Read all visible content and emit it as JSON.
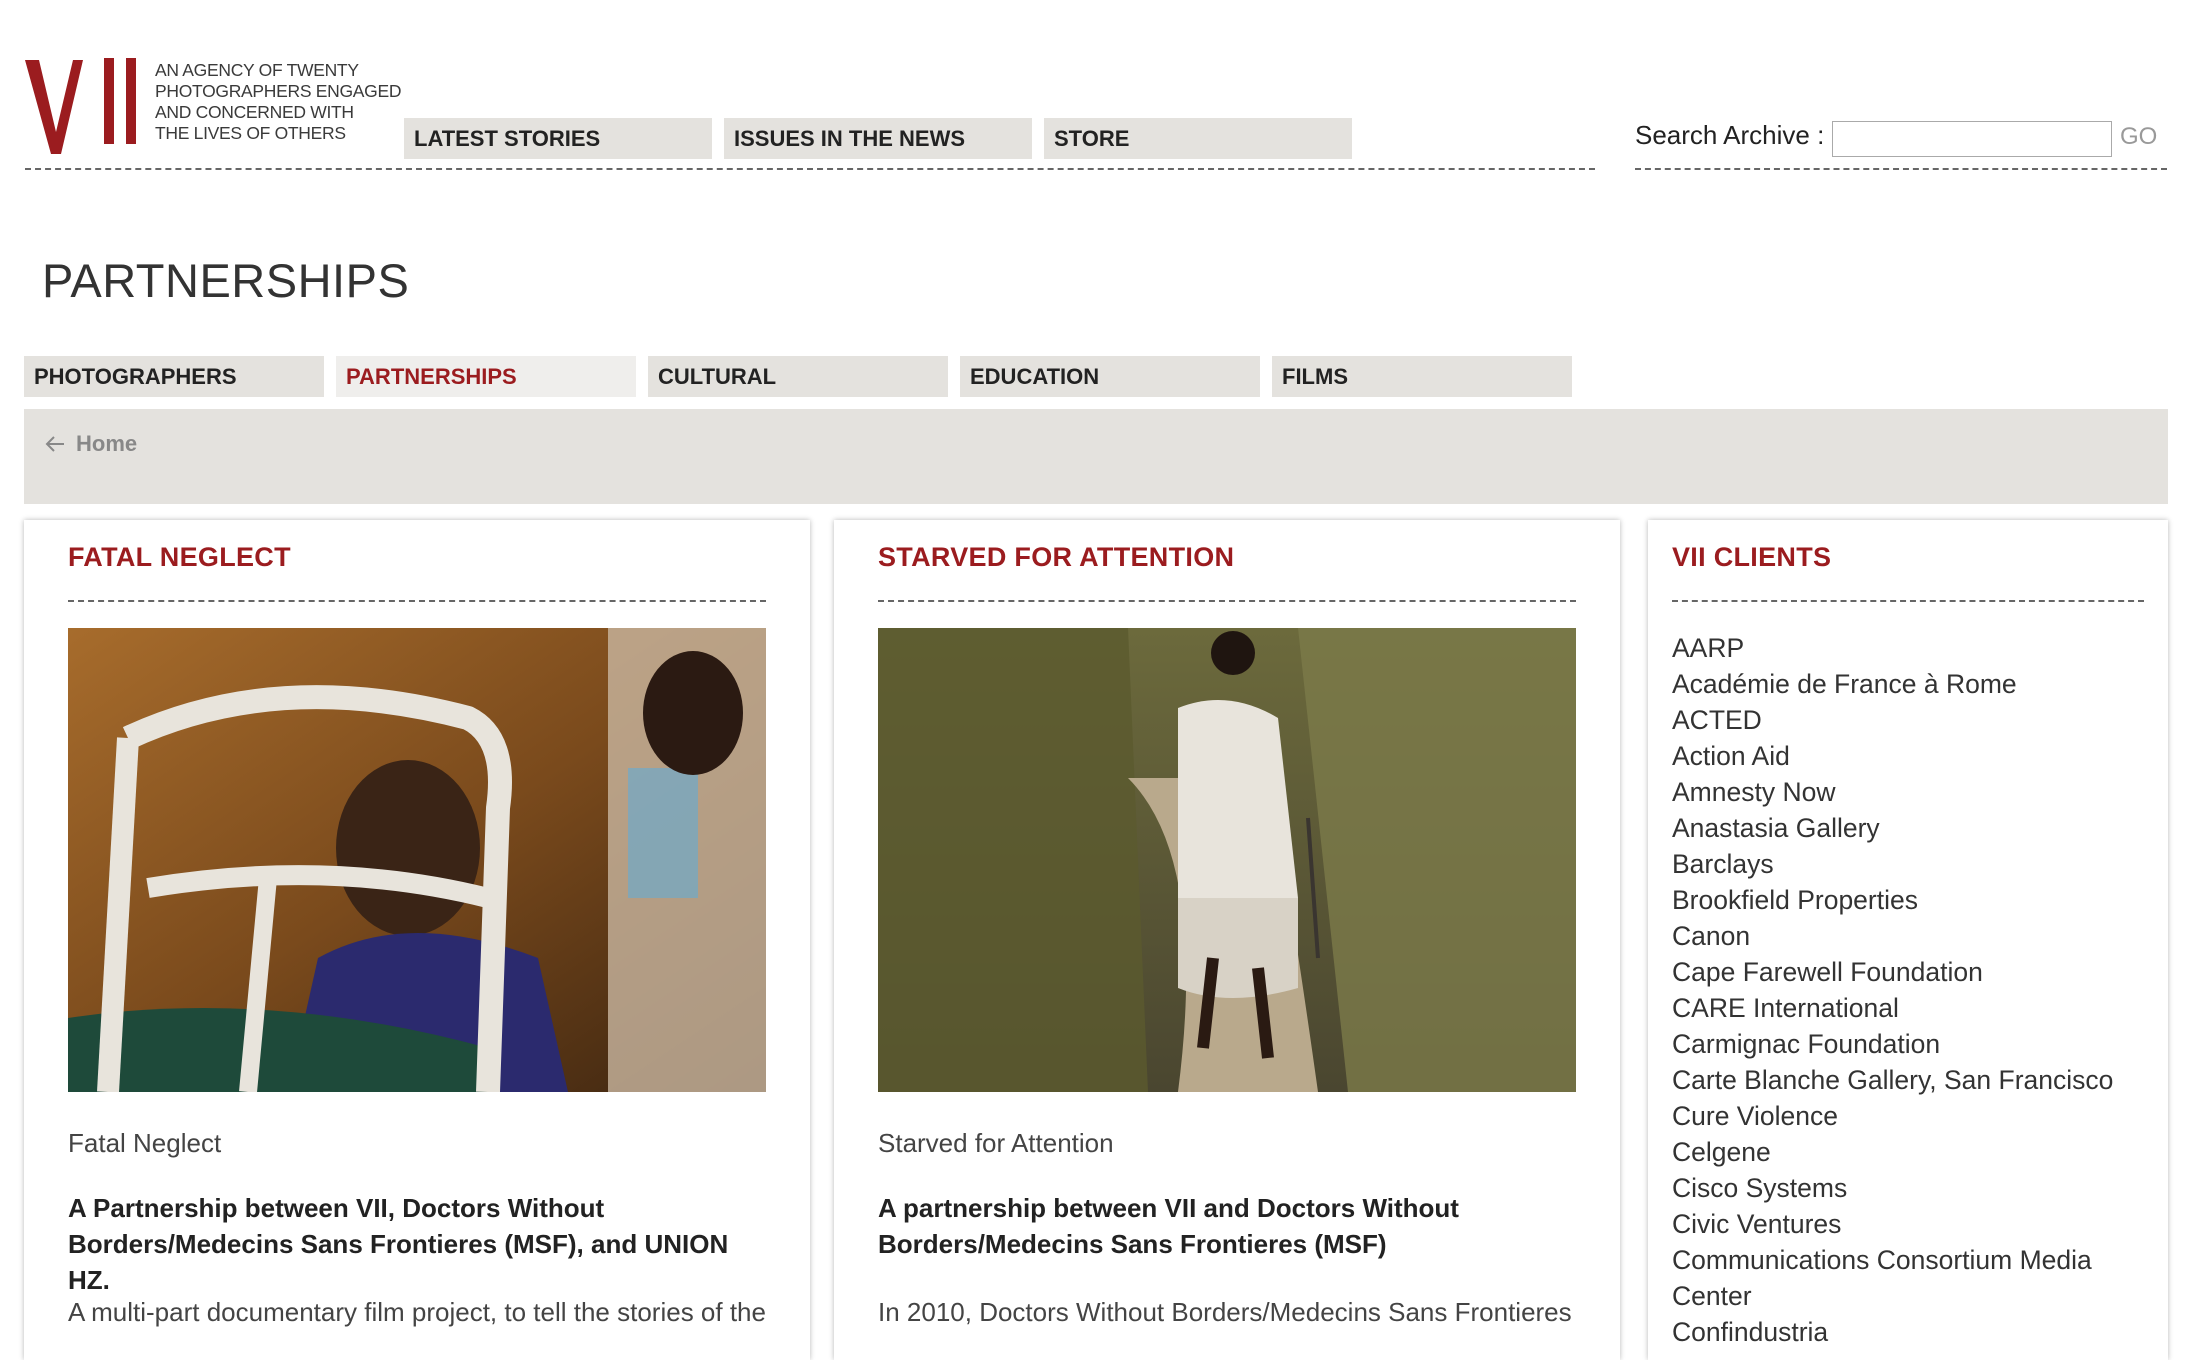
{
  "header": {
    "logo_text": "VII",
    "tagline": [
      "AN AGENCY OF TWENTY",
      "PHOTOGRAPHERS ENGAGED",
      "AND CONCERNED WITH",
      "THE LIVES OF OTHERS"
    ],
    "nav": [
      {
        "label": "LATEST STORIES"
      },
      {
        "label": "ISSUES IN THE NEWS"
      },
      {
        "label": "STORE"
      }
    ],
    "search": {
      "label": "Search Archive :",
      "value": "",
      "button": "GO"
    }
  },
  "page_title": "PARTNERSHIPS",
  "subnav": [
    {
      "label": "PHOTOGRAPHERS",
      "active": false
    },
    {
      "label": "PARTNERSHIPS",
      "active": true
    },
    {
      "label": "CULTURAL",
      "active": false
    },
    {
      "label": "EDUCATION",
      "active": false
    },
    {
      "label": "FILMS",
      "active": false
    }
  ],
  "breadcrumb": {
    "label": "Home"
  },
  "cards": [
    {
      "title": "FATAL NEGLECT",
      "caption": "Fatal Neglect",
      "subtitle": "A Partnership between VII, Doctors Without Borders/Medecins Sans Frontieres (MSF), and UNION HZ.",
      "text": "A multi-part documentary film project, to tell the stories of the"
    },
    {
      "title": "STARVED FOR ATTENTION",
      "caption": "Starved for Attention",
      "subtitle": "A partnership between VII and Doctors Without Borders/Medecins Sans Frontieres (MSF)",
      "text": "In 2010, Doctors Without Borders/Medecins Sans Frontieres"
    }
  ],
  "clients": {
    "title": "VII CLIENTS",
    "items": [
      "AARP",
      "Académie de France à Rome",
      "ACTED",
      "Action Aid",
      "Amnesty Now",
      "Anastasia Gallery",
      "Barclays",
      "Brookfield Properties",
      "Canon",
      "Cape Farewell Foundation",
      "CARE International",
      "Carmignac Foundation",
      "Carte Blanche Gallery, San Francisco",
      "Cure Violence",
      "Celgene",
      "Cisco Systems",
      "Civic Ventures",
      "Communications Consortium Media Center",
      "Confindustria"
    ]
  },
  "colors": {
    "accent": "#9b1c1f",
    "nav_bg": "#e4e2de",
    "nav_active_bg": "#efeeec"
  }
}
